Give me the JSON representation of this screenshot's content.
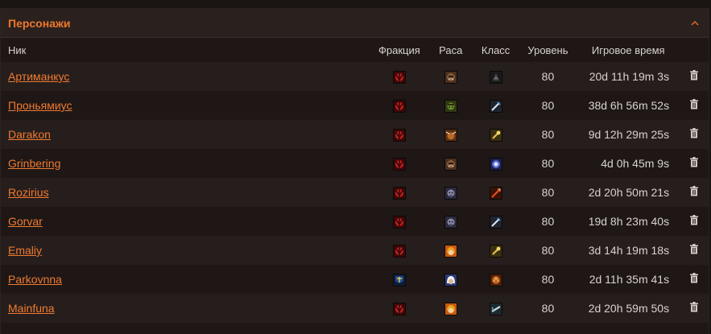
{
  "panel": {
    "title": "Персонажи"
  },
  "columns": {
    "nick": "Ник",
    "faction": "Фракция",
    "race": "Раса",
    "class": "Класс",
    "level": "Уровень",
    "playtime": "Игровое время"
  },
  "characters": [
    {
      "name": "Артиманкус",
      "faction": "horde-icon",
      "race": "orc-male-icon",
      "class": "warlock-icon",
      "level": "80",
      "playtime": "20d 11h 19m 3s"
    },
    {
      "name": "Проньямиус",
      "faction": "horde-icon",
      "race": "goblin-male-icon",
      "class": "rogue-icon",
      "level": "80",
      "playtime": "38d 6h 56m 52s"
    },
    {
      "name": "Darakon",
      "faction": "horde-icon",
      "race": "tauren-male-icon",
      "class": "paladin-icon",
      "level": "80",
      "playtime": "9d 12h 29m 25s"
    },
    {
      "name": "Grinbering",
      "faction": "horde-icon",
      "race": "orc-male-icon",
      "class": "mage-icon",
      "level": "80",
      "playtime": "4d 0h 45m 9s"
    },
    {
      "name": "Rozirius",
      "faction": "horde-icon",
      "race": "undead-male-icon",
      "class": "hunter-icon",
      "level": "80",
      "playtime": "2d 20h 50m 21s"
    },
    {
      "name": "Gorvar",
      "faction": "horde-icon",
      "race": "undead-male-icon",
      "class": "rogue-icon",
      "level": "80",
      "playtime": "19d 8h 23m 40s"
    },
    {
      "name": "Emaliy",
      "faction": "horde-icon",
      "race": "bloodelf-female-icon",
      "class": "paladin-icon",
      "level": "80",
      "playtime": "3d 14h 19m 18s"
    },
    {
      "name": "Parkovnna",
      "faction": "alliance-icon",
      "race": "human-female-icon",
      "class": "druid-icon",
      "level": "80",
      "playtime": "2d 11h 35m 41s"
    },
    {
      "name": "Mainfuna",
      "faction": "horde-icon",
      "race": "bloodelf-female-icon",
      "class": "warrior-icon",
      "level": "80",
      "playtime": "2d 20h 59m 50s"
    }
  ],
  "colors": {
    "accent": "#f0772a",
    "horde": "#b01818",
    "alliance": "#1c3f7a"
  }
}
